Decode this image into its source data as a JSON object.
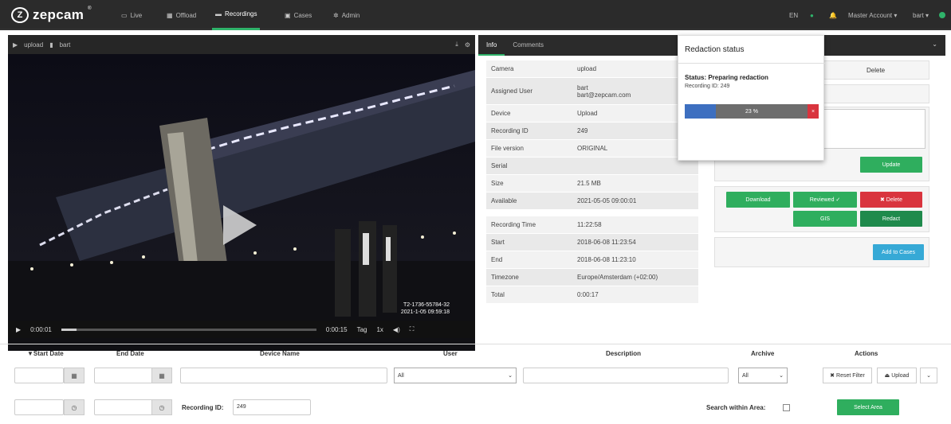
{
  "app": {
    "logo_text": "zepcam",
    "logo_sup": "®"
  },
  "nav": [
    {
      "label": "Live",
      "icon": "live-icon"
    },
    {
      "label": "Offload",
      "icon": "offload-icon"
    },
    {
      "label": "Recordings",
      "icon": "folder-icon",
      "active": true
    },
    {
      "label": "Cases",
      "icon": "cases-icon"
    },
    {
      "label": "Admin",
      "icon": "gear-icon"
    }
  ],
  "topright": {
    "lang": "EN",
    "account": "Master Account",
    "user": "bart"
  },
  "player": {
    "upload": "upload",
    "user": "bart",
    "time_current": "0:00:01",
    "time_total": "0:00:15",
    "tag": "Tag",
    "speed": "1x",
    "overlay_id": "T2-1736-55784-32",
    "overlay_time": "2021-1-05 09:59:18"
  },
  "info": {
    "tabs": [
      "Info",
      "Comments"
    ],
    "rows": [
      {
        "k": "Camera",
        "v": "upload"
      },
      {
        "k": "Assigned User",
        "v": "bart",
        "v2": "bart@zepcam.com"
      },
      {
        "k": "Device",
        "v": "Upload"
      },
      {
        "k": "Recording ID",
        "v": "249"
      },
      {
        "k": "File version",
        "v": "ORIGINAL"
      },
      {
        "k": "Serial",
        "v": ""
      },
      {
        "k": "Size",
        "v": "21.5 MB"
      },
      {
        "k": "Available",
        "v": "2021-05-05 09:00:01"
      },
      {
        "k": "Recording Time",
        "v": "11:22:58"
      },
      {
        "k": "Start",
        "v": "2018-06-08 11:23:54"
      },
      {
        "k": "End",
        "v": "2018-06-08 11:23:10"
      },
      {
        "k": "Timezone",
        "v": "Europe/Amsterdam (+02:00)"
      },
      {
        "k": "Total",
        "v": "0:00:17"
      }
    ]
  },
  "right": {
    "field1": "Delete",
    "update": "Update",
    "download": "Download",
    "reviewed": "Reviewed ✓",
    "delete": "✖ Delete",
    "gis": "GIS",
    "redact": "Redact",
    "add_cases": "Add to Cases"
  },
  "popup": {
    "title": "Redaction status",
    "status_label": "Status: Preparing redaction",
    "rec_id": "Recording ID: 249",
    "progress_pct": 23,
    "progress_text": "23 %"
  },
  "filters": {
    "headers": [
      "▼Start Date",
      "End Date",
      "Device Name",
      "User",
      "Description",
      "Archive",
      "Actions"
    ],
    "user_sel": "All",
    "archive_sel": "All",
    "reset": "Reset Filter",
    "upload": "Upload",
    "recid_label": "Recording ID:",
    "recid_val": "249",
    "search_area": "Search within Area:",
    "select_area": "Select Area"
  },
  "colors": {
    "accent": "#2fb36a",
    "navbar": "#2b2b2b",
    "danger": "#d9343e",
    "info": "#36a9d6"
  }
}
